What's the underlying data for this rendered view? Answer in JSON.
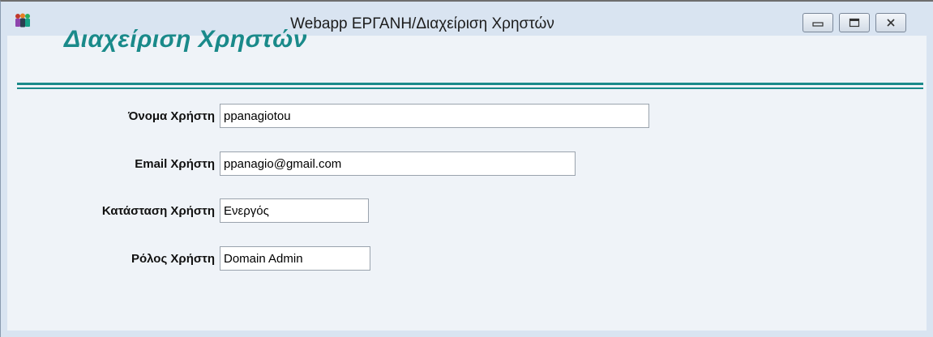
{
  "window": {
    "title": "Webapp ΕΡΓΑΝΗ/Διαχείριση Χρηστών",
    "app_icon": "users-group-icon",
    "controls": [
      "minimize-icon",
      "maximize-icon",
      "close-icon"
    ]
  },
  "header": {
    "title": "Διαχείριση Χρηστών"
  },
  "form": {
    "username": {
      "label": "Όνομα Χρήστη",
      "value": "ppanagiotou"
    },
    "email": {
      "label": "Email Χρήστη",
      "value": "ppanagio@gmail.com"
    },
    "status": {
      "label": "Κατάσταση Χρήστη",
      "value": "Ενεργός"
    },
    "role": {
      "label": "Ρόλος Χρήστη",
      "value": "Domain Admin"
    }
  },
  "colors": {
    "accent": "#1a8a8a",
    "background": "#eff3f8"
  }
}
